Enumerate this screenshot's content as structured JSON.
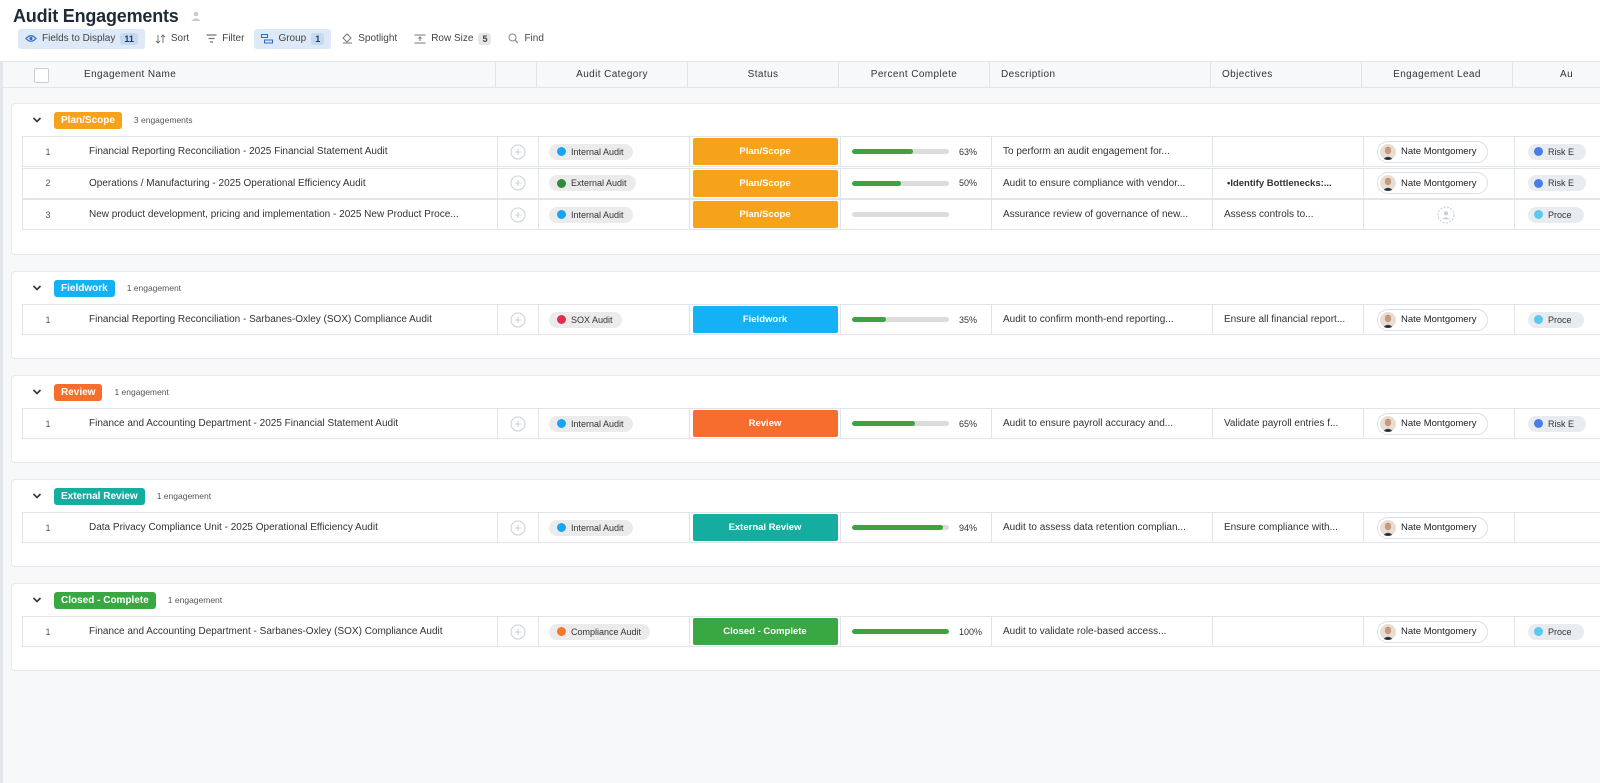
{
  "page": {
    "title": "Audit Engagements"
  },
  "toolbar": {
    "fields_label": "Fields to Display",
    "fields_count": "11",
    "sort_label": "Sort",
    "filter_label": "Filter",
    "group_label": "Group",
    "group_count": "1",
    "spotlight_label": "Spotlight",
    "rowsize_label": "Row Size",
    "rowsize_count": "5",
    "find_label": "Find"
  },
  "columns": {
    "name": "Engagement Name",
    "category": "Audit Category",
    "status": "Status",
    "percent": "Percent Complete",
    "description": "Description",
    "objectives": "Objectives",
    "lead": "Engagement Lead",
    "next": "Au"
  },
  "colors": {
    "plan": "#f6a21a",
    "fieldwork": "#14b1f5",
    "review": "#f66d2d",
    "external": "#14ad9f",
    "closed": "#3aa842",
    "internal_dot": "#1aa3ef",
    "external_dot": "#2e8b3a",
    "sox_dot": "#e2324b",
    "compliance_dot": "#f5772c",
    "risk_dot": "#4a7be8",
    "process_dot": "#5bc8ef"
  },
  "groups": [
    {
      "label": "Plan/Scope",
      "count": "3 engagements",
      "rows": [
        {
          "num": "1",
          "name": "Financial Reporting Reconciliation - 2025 Financial Statement Audit",
          "category": "Internal Audit",
          "status": "Plan/Scope",
          "percent": 63,
          "percent_label": "63%",
          "description": "To perform an audit engagement for...",
          "objectives": "",
          "lead": "Nate Montgomery",
          "risk": "Risk E"
        },
        {
          "num": "2",
          "name": "Operations / Manufacturing - 2025 Operational Efficiency Audit",
          "category": "External Audit",
          "status": "Plan/Scope",
          "percent": 50,
          "percent_label": "50%",
          "description": "Audit to ensure compliance with vendor...",
          "objectives": "Identify Bottlenecks:...",
          "lead": "Nate Montgomery",
          "risk": "Risk E"
        },
        {
          "num": "3",
          "name": "New product development, pricing and implementation - 2025 New Product Proce...",
          "category": "Internal Audit",
          "status": "Plan/Scope",
          "percent": 0,
          "percent_label": "",
          "description": "Assurance review of governance of new...",
          "objectives": "Assess controls to...",
          "lead": "",
          "risk": "Proce"
        }
      ]
    },
    {
      "label": "Fieldwork",
      "count": "1 engagement",
      "rows": [
        {
          "num": "1",
          "name": "Financial Reporting Reconciliation - Sarbanes-Oxley (SOX) Compliance Audit",
          "category": "SOX Audit",
          "status": "Fieldwork",
          "percent": 35,
          "percent_label": "35%",
          "description": "Audit to confirm month-end reporting...",
          "objectives": "Ensure all financial report...",
          "lead": "Nate Montgomery",
          "risk": "Proce"
        }
      ]
    },
    {
      "label": "Review",
      "count": "1 engagement",
      "rows": [
        {
          "num": "1",
          "name": "Finance and Accounting Department - 2025 Financial Statement Audit",
          "category": "Internal Audit",
          "status": "Review",
          "percent": 65,
          "percent_label": "65%",
          "description": "Audit to ensure payroll accuracy and...",
          "objectives": "Validate payroll entries f...",
          "lead": "Nate Montgomery",
          "risk": "Risk E"
        }
      ]
    },
    {
      "label": "External Review",
      "count": "1 engagement",
      "rows": [
        {
          "num": "1",
          "name": "Data Privacy Compliance Unit - 2025 Operational Efficiency Audit",
          "category": "Internal Audit",
          "status": "External Review",
          "percent": 94,
          "percent_label": "94%",
          "description": "Audit to assess data retention complian...",
          "objectives": "Ensure compliance with...",
          "lead": "Nate Montgomery",
          "risk": ""
        }
      ]
    },
    {
      "label": "Closed - Complete",
      "count": "1 engagement",
      "rows": [
        {
          "num": "1",
          "name": "Finance and Accounting Department - Sarbanes-Oxley (SOX) Compliance Audit",
          "category": "Compliance Audit",
          "status": "Closed - Complete",
          "percent": 100,
          "percent_label": "100%",
          "description": "Audit to validate role-based access...",
          "objectives": "",
          "lead": "Nate Montgomery",
          "risk": "Proce"
        }
      ]
    }
  ]
}
